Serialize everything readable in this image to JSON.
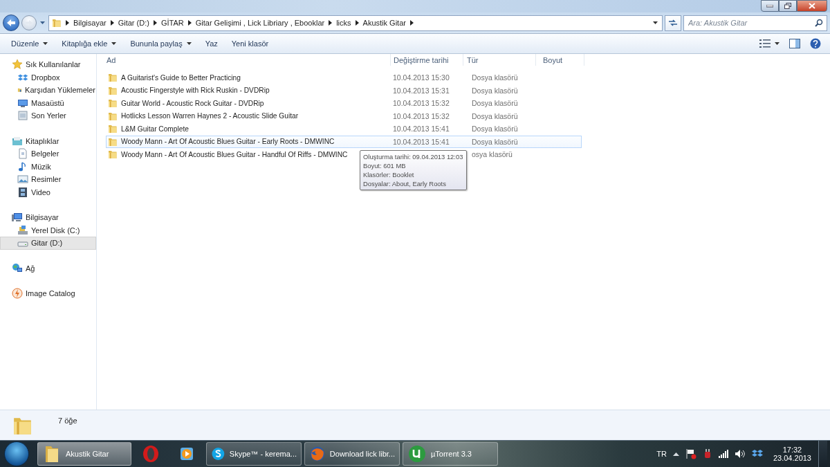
{
  "address": {
    "breadcrumb": [
      "Bilgisayar",
      "Gitar (D:)",
      "GİTAR",
      "Gitar Gelişimi , Lick Libriary , Ebooklar",
      "licks",
      "Akustik Gitar"
    ],
    "search_placeholder": "Ara: Akustik Gitar"
  },
  "toolbar": [
    {
      "label": "Düzenle",
      "dropdown": true
    },
    {
      "label": "Kitaplığa ekle",
      "dropdown": true
    },
    {
      "label": "Bununla paylaş",
      "dropdown": true
    },
    {
      "label": "Yaz",
      "dropdown": false
    },
    {
      "label": "Yeni klasör",
      "dropdown": false
    }
  ],
  "sidebar": [
    {
      "label": "Sık Kullanılanlar",
      "children": [
        {
          "label": "Dropbox",
          "selected": false
        },
        {
          "label": "Karşıdan Yüklemeler",
          "selected": false
        },
        {
          "label": "Masaüstü",
          "selected": false
        },
        {
          "label": "Son Yerler",
          "selected": false
        }
      ]
    },
    {
      "label": "Kitaplıklar",
      "children": [
        {
          "label": "Belgeler",
          "selected": false
        },
        {
          "label": "Müzik",
          "selected": false
        },
        {
          "label": "Resimler",
          "selected": false
        },
        {
          "label": "Video",
          "selected": false
        }
      ]
    },
    {
      "label": "Bilgisayar",
      "children": [
        {
          "label": "Yerel Disk (C:)",
          "selected": false
        },
        {
          "label": "Gitar (D:)",
          "selected": true
        }
      ]
    },
    {
      "label": "Ağ"
    },
    {
      "label": "Image Catalog"
    }
  ],
  "columns": [
    "Ad",
    "Değiştirme tarihi",
    "Tür",
    "Boyut"
  ],
  "rows": [
    {
      "name": "A Guitarist's Guide to Better Practicing",
      "date": "10.04.2013 15:30",
      "type": "Dosya klasörü",
      "hovered": false
    },
    {
      "name": "Acoustic Fingerstyle with Rick Ruskin - DVDRip",
      "date": "10.04.2013 15:31",
      "type": "Dosya klasörü",
      "hovered": false
    },
    {
      "name": "Guitar World - Acoustic Rock Guitar - DVDRip",
      "date": "10.04.2013 15:32",
      "type": "Dosya klasörü",
      "hovered": false
    },
    {
      "name": "Hotlicks Lesson Warren Haynes 2 - Acoustic Slide Guitar",
      "date": "10.04.2013 15:32",
      "type": "Dosya klasörü",
      "hovered": false
    },
    {
      "name": "L&M Guitar Complete",
      "date": "10.04.2013 15:41",
      "type": "Dosya klasörü",
      "hovered": false
    },
    {
      "name": "Woody Mann - Art Of Acoustic Blues Guitar - Early Roots - DMWINC",
      "date": "10.04.2013 15:41",
      "type": "Dosya klasörü",
      "hovered": true
    },
    {
      "name": "Woody Mann - Art Of Acoustic Blues Guitar - Handful Of Riffs - DMWINC",
      "type": "osya klasörü",
      "hovered": false
    }
  ],
  "tooltip": {
    "lines": [
      "Oluşturma tarihi: 09.04.2013 12:03",
      "Boyut: 601 MB",
      "Klasörler: Booklet",
      "Dosyalar: About, Early Roots"
    ]
  },
  "details": {
    "count": "7 öğe"
  },
  "taskbar": {
    "items": [
      {
        "label": "Akustik Gitar",
        "active": true
      },
      {
        "active": false
      },
      {
        "active": false
      },
      {
        "label": "Skype™ - kerema...",
        "active": false
      },
      {
        "label": "Download lick libr...",
        "active": false
      },
      {
        "label": "µTorrent 3.3",
        "active": false
      }
    ],
    "language": "TR",
    "time": "17:32",
    "date": "23.04.2013"
  }
}
